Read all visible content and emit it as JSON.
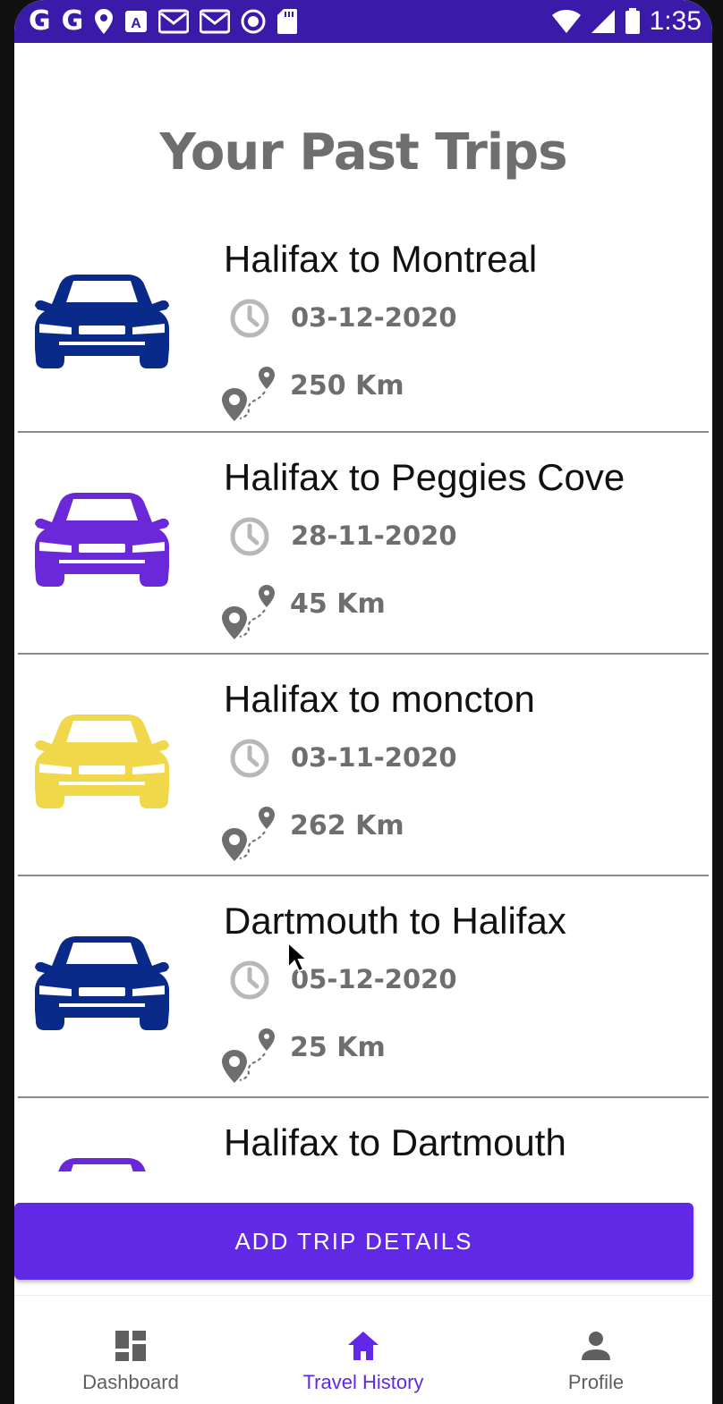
{
  "status_bar": {
    "left_icons": [
      "google-icon",
      "google-icon",
      "location-icon",
      "a-icon",
      "gmail-icon",
      "gmail-icon",
      "record-icon",
      "sdcard-icon"
    ],
    "left_glyphs": [
      "G",
      "G"
    ],
    "time": "1:35"
  },
  "page": {
    "title": "Your Past Trips"
  },
  "trips": [
    {
      "name": "Halifax to Montreal",
      "date": "03-12-2020",
      "distance": "250 Km",
      "car_color": "#0a2a8a"
    },
    {
      "name": "Halifax to Peggies Cove",
      "date": "28-11-2020",
      "distance": "45 Km",
      "car_color": "#6a28d8"
    },
    {
      "name": "Halifax to moncton",
      "date": "03-11-2020",
      "distance": "262 Km",
      "car_color": "#f0d84a"
    },
    {
      "name": "Dartmouth to Halifax",
      "date": "05-12-2020",
      "distance": "25 Km",
      "car_color": "#0a2a8a"
    },
    {
      "name": "Halifax to Dartmouth",
      "date": "",
      "distance": "",
      "car_color": "#6a28d8"
    }
  ],
  "actions": {
    "add_trip_label": "ADD TRIP DETAILS"
  },
  "bottom_nav": {
    "items": [
      {
        "label": "Dashboard",
        "icon": "dashboard-icon",
        "active": false
      },
      {
        "label": "Travel History",
        "icon": "home-icon",
        "active": true
      },
      {
        "label": "Profile",
        "icon": "person-icon",
        "active": false
      }
    ]
  },
  "colors": {
    "primary": "#6128e6",
    "status_bar": "#3a1aa8",
    "muted_text": "#6e6e6e",
    "icon_gray": "#b8b8b8"
  }
}
